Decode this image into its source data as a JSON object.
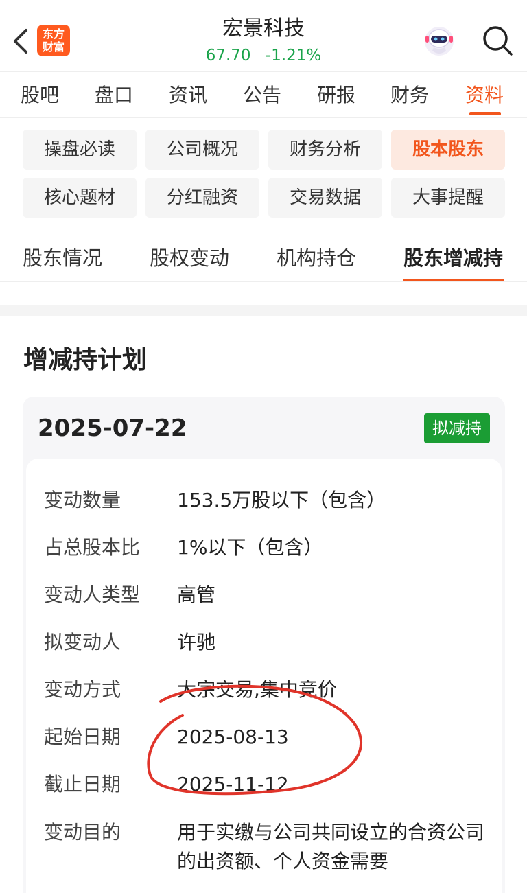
{
  "header": {
    "logo_line1": "东方",
    "logo_line2": "财富",
    "stock_name": "宏景科技",
    "price": "67.70",
    "change": "-1.21%",
    "quote_color": "#1aa34a"
  },
  "main_tabs": [
    "股吧",
    "盘口",
    "资讯",
    "公告",
    "研报",
    "财务",
    "资料"
  ],
  "main_tab_active": "资料",
  "categories": [
    "操盘必读",
    "公司概况",
    "财务分析",
    "股本股东",
    "核心题材",
    "分红融资",
    "交易数据",
    "大事提醒"
  ],
  "category_active": "股本股东",
  "sub_tabs": [
    "股东情况",
    "股权变动",
    "机构持仓",
    "股东增减持"
  ],
  "sub_tab_active": "股东增减持",
  "plan": {
    "section_title": "增减持计划",
    "date": "2025-07-22",
    "badge": "拟减持",
    "badge_color": "#1b9d34",
    "rows": [
      {
        "label": "变动数量",
        "value": "153.5万股以下（包含）"
      },
      {
        "label": "占总股本比",
        "value": "1%以下（包含）"
      },
      {
        "label": "变动人类型",
        "value": "高管"
      },
      {
        "label": "拟变动人",
        "value": "许驰"
      },
      {
        "label": "变动方式",
        "value": "大宗交易,集中竞价"
      },
      {
        "label": "起始日期",
        "value": "2025-08-13"
      },
      {
        "label": "截止日期",
        "value": "2025-11-12"
      },
      {
        "label": "变动目的",
        "value": "用于实缴与公司共同设立的合资公司的出资额、个人资金需要"
      }
    ]
  },
  "accent_color": "#f2561d"
}
